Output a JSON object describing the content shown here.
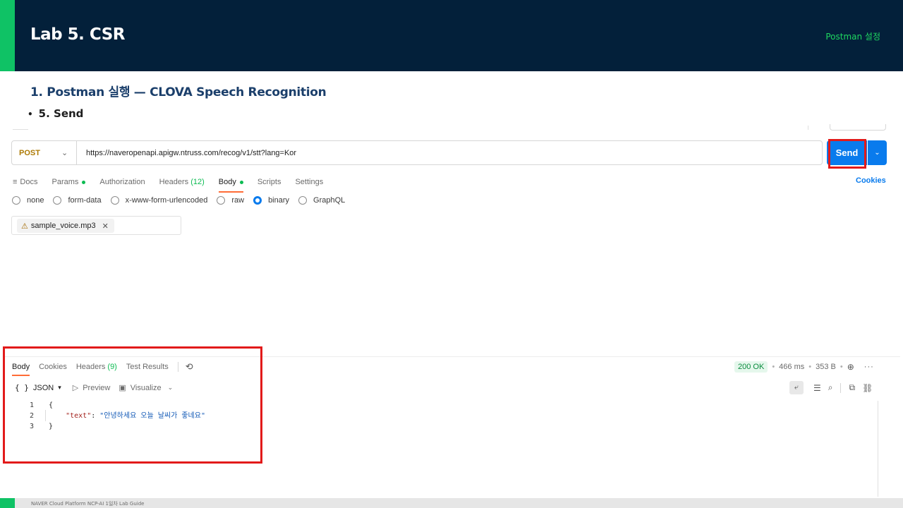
{
  "slide": {
    "title": "Lab 5. CSR",
    "section": "Postman 설정",
    "step_heading": "1.  Postman 실행 — CLOVA Speech Recognition",
    "step_bullet": "5. Send",
    "footer": "NAVER Cloud Platform  NCP-AI 1일차 Lab Guide",
    "accent_color": "#0fc265",
    "header_color": "#03203a"
  },
  "request": {
    "method": "POST",
    "url": "https://naveropenapi.apigw.ntruss.com/recog/v1/stt?lang=Kor",
    "send_label": "Send",
    "tabs": [
      {
        "label": "Docs"
      },
      {
        "label": "Params"
      },
      {
        "label": "Authorization"
      },
      {
        "label": "Headers",
        "count": "(12)"
      },
      {
        "label": "Body"
      },
      {
        "label": "Scripts"
      },
      {
        "label": "Settings"
      }
    ],
    "cookies_label": "Cookies",
    "body_types": [
      "none",
      "form-data",
      "x-www-form-urlencoded",
      "raw",
      "binary",
      "GraphQL"
    ],
    "selected_body_type": "binary",
    "file_name": "sample_voice.mp3"
  },
  "response": {
    "tabs": [
      {
        "label": "Body"
      },
      {
        "label": "Cookies"
      },
      {
        "label": "Headers",
        "count": "(9)"
      },
      {
        "label": "Test Results"
      }
    ],
    "status": "200 OK",
    "time": "466 ms",
    "size": "353 B",
    "format": "JSON",
    "preview_label": "Preview",
    "visualize_label": "Visualize",
    "lines": [
      {
        "n": "1",
        "text": "{"
      },
      {
        "n": "2",
        "key": "\"text\"",
        "value": "\"안녕하세요 오늘 날씨가 좋네요\""
      },
      {
        "n": "3",
        "text": "}"
      }
    ]
  }
}
